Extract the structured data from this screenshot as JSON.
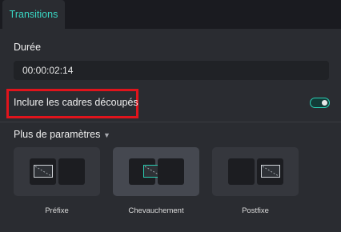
{
  "tabs": [
    {
      "label": "Transitions"
    }
  ],
  "duration": {
    "label": "Durée",
    "value": "00:00:02:14"
  },
  "crop": {
    "label": "Inclure les cadres découpés",
    "enabled": true
  },
  "params": {
    "label": "Plus de paramètres"
  },
  "modes": [
    {
      "label": "Préfixe",
      "selected": false
    },
    {
      "label": "Chevauchement",
      "selected": true
    },
    {
      "label": "Postfixe",
      "selected": false
    }
  ],
  "colors": {
    "accent": "#39d5c2",
    "highlight": "#e0141c",
    "panel": "#2a2c31"
  }
}
